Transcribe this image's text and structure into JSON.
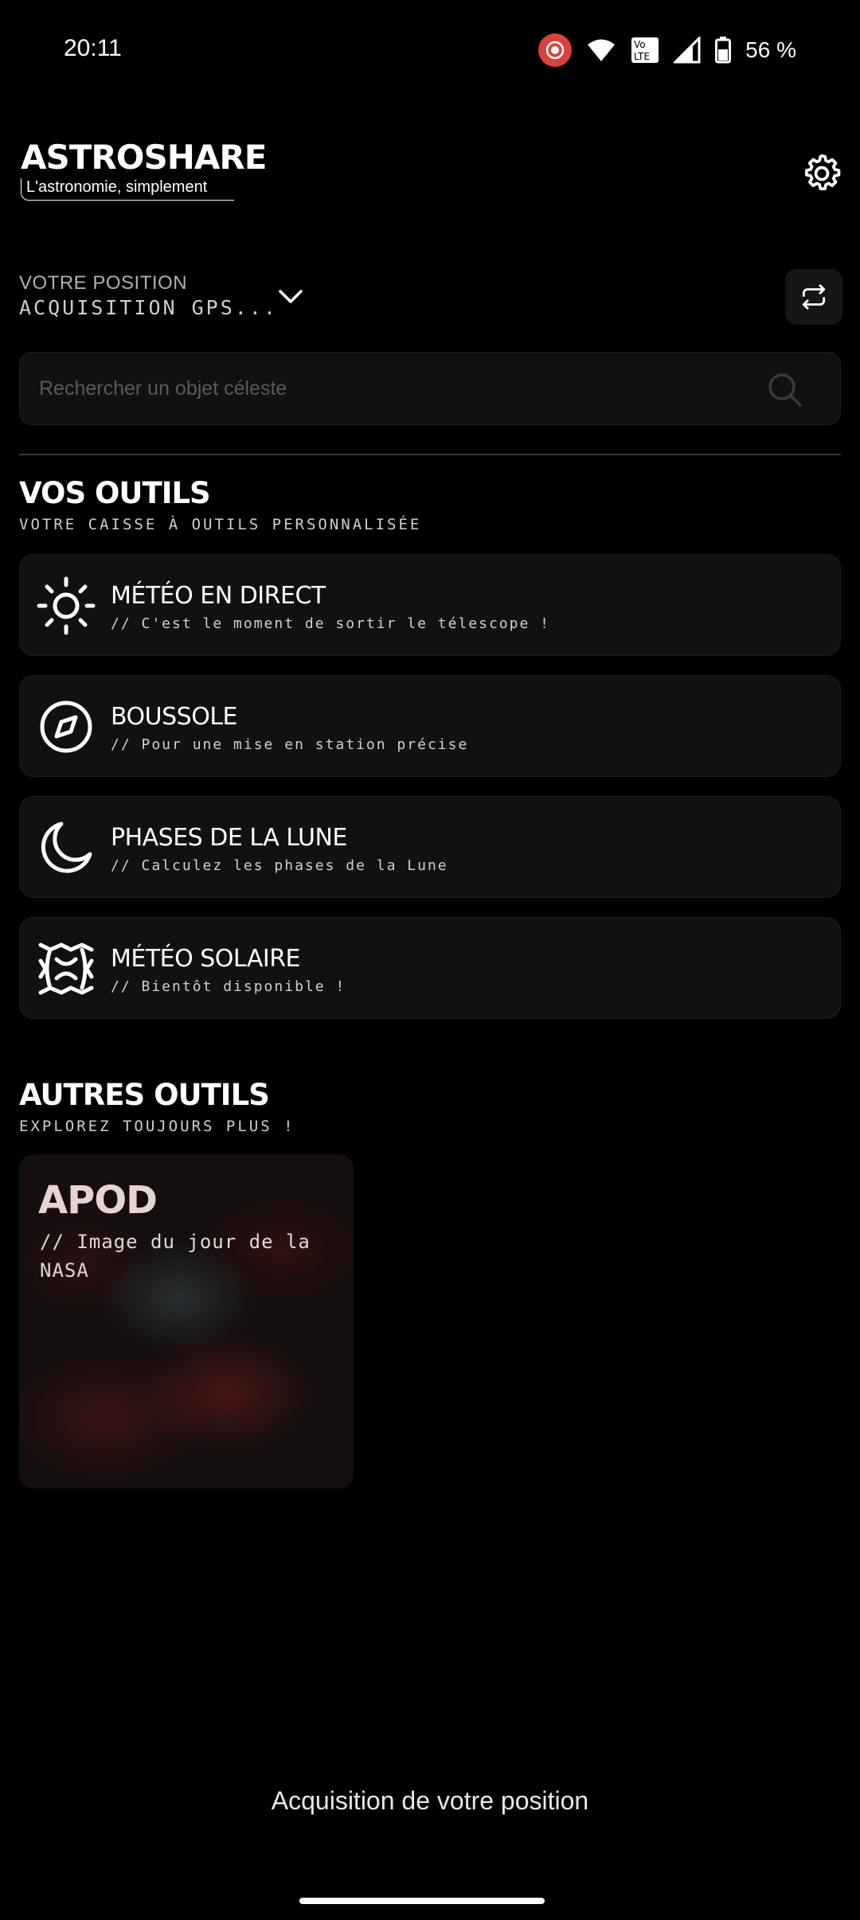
{
  "status_bar": {
    "time": "20:11",
    "battery": "56 %",
    "icons": [
      "screen-record-icon",
      "wifi-icon",
      "volte-icon",
      "signal-icon",
      "battery-icon"
    ]
  },
  "header": {
    "title": "ASTROSHARE",
    "tagline": "L'astronomie, simplement"
  },
  "position": {
    "label": "VOTRE POSITION",
    "value": "ACQUISITION GPS..."
  },
  "search": {
    "placeholder": "Rechercher un objet céleste"
  },
  "tools_section": {
    "title": "VOS OUTILS",
    "subtitle": "VOTRE CAISSE À OUTILS PERSONNALISÉE",
    "items": [
      {
        "name": "MÉTÉO EN DIRECT",
        "desc": "// C'est le moment de sortir le télescope !",
        "icon": "sun-icon"
      },
      {
        "name": "BOUSSOLE",
        "desc": "// Pour une mise en station précise",
        "icon": "compass-icon"
      },
      {
        "name": "PHASES DE LA LUNE",
        "desc": "// Calculez les phases de la Lune",
        "icon": "moon-icon"
      },
      {
        "name": "MÉTÉO SOLAIRE",
        "desc": "// Bientôt disponible !",
        "icon": "solar-flare-icon"
      }
    ]
  },
  "other_section": {
    "title": "AUTRES OUTILS",
    "subtitle": "EXPLOREZ TOUJOURS PLUS !",
    "apod": {
      "title": "APOD",
      "desc": "// Image du jour de la NASA"
    }
  },
  "toast": "Acquisition de votre position",
  "colors": {
    "background": "#000000",
    "card": "#111111",
    "record_red": "#d8433b"
  }
}
